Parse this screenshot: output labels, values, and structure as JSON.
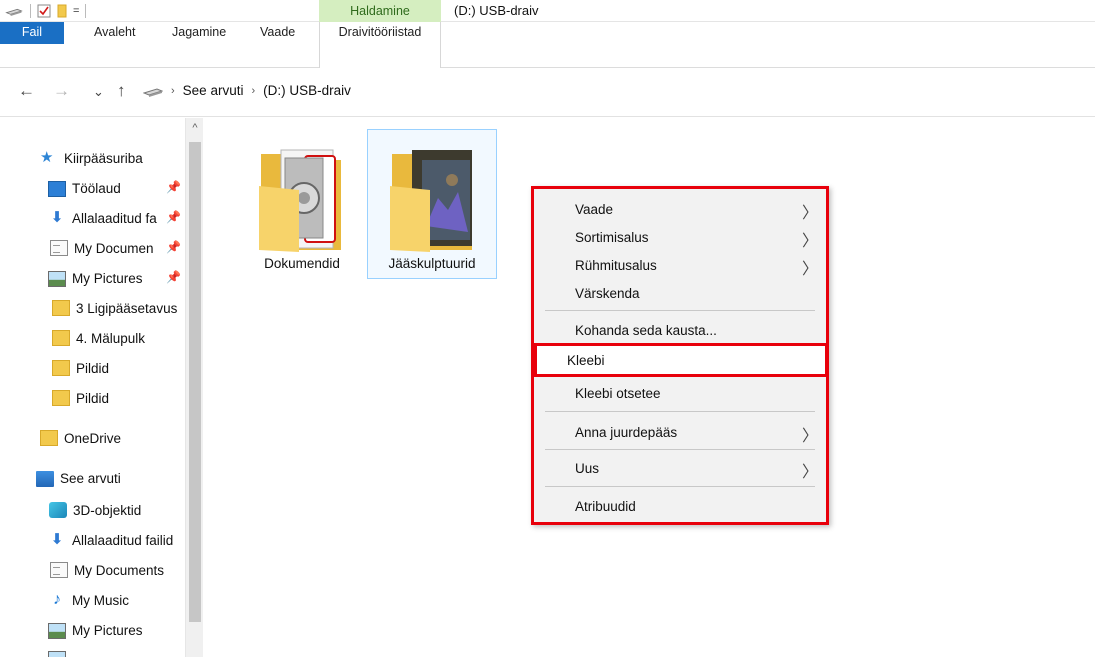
{
  "title_bar": {
    "context_tab_group": "Haldamine",
    "window_title": "(D:) USB-draiv",
    "qat_dropdown": "="
  },
  "ribbon": {
    "tabs": [
      "Fail",
      "Avaleht",
      "Jagamine",
      "Vaade"
    ],
    "context_tab": "Draivitööriistad"
  },
  "address": {
    "back": "←",
    "forward": "→",
    "recent": "⌄",
    "up": "↑",
    "separator": "›",
    "crumbs": [
      "See arvuti",
      "(D:) USB-draiv"
    ]
  },
  "sidebar": {
    "scroll_up": "^",
    "items": [
      {
        "label": "Kiirpääsuriba",
        "icon": "star-icon"
      },
      {
        "label": "Töölaud",
        "icon": "desktop-icon",
        "pinned": true
      },
      {
        "label": "Allalaaditud fa",
        "icon": "download-icon",
        "pinned": true
      },
      {
        "label": "My Documen",
        "icon": "document-icon",
        "pinned": true
      },
      {
        "label": "My Pictures",
        "icon": "pictures-icon",
        "pinned": true
      },
      {
        "label": "3 Ligipääsetavus",
        "icon": "folder-icon"
      },
      {
        "label": "4. Mälupulk",
        "icon": "folder-icon"
      },
      {
        "label": "Pildid",
        "icon": "folder-icon"
      },
      {
        "label": "Pildid",
        "icon": "folder-icon"
      },
      {
        "label": "OneDrive",
        "icon": "folder-icon"
      },
      {
        "label": "See arvuti",
        "icon": "computer-icon"
      },
      {
        "label": "3D-objektid",
        "icon": "3d-objects-icon"
      },
      {
        "label": "Allalaaditud failid",
        "icon": "download-icon"
      },
      {
        "label": "My Documents",
        "icon": "document-icon"
      },
      {
        "label": "My Music",
        "icon": "music-icon"
      },
      {
        "label": "My Pictures",
        "icon": "pictures-icon"
      }
    ],
    "pin_glyph": "📌"
  },
  "files": [
    {
      "label": "Dokumendid",
      "selected": false
    },
    {
      "label": "Jääskulptuurid",
      "selected": true
    }
  ],
  "context_menu": {
    "items": [
      {
        "label": "Vaade",
        "submenu": true
      },
      {
        "label": "Sortimisalus",
        "submenu": true
      },
      {
        "label": "Rühmitusalus",
        "submenu": true
      },
      {
        "label": "Värskenda",
        "submenu": false
      },
      {
        "label": "Kohanda seda kausta...",
        "submenu": false
      },
      {
        "label": "Kleebi",
        "submenu": false
      },
      {
        "label": "Kleebi otsetee",
        "submenu": false
      },
      {
        "label": "Anna juurdepääs",
        "submenu": true
      },
      {
        "label": "Uus",
        "submenu": true
      },
      {
        "label": "Atribuudid",
        "submenu": false
      }
    ],
    "arrow_glyph": "〉"
  },
  "colors": {
    "file_tab": "#1a6fc4",
    "context_tab": "#d5eec0",
    "annotation_red": "#e8000b",
    "folder_yellow": "#f2c94c"
  }
}
